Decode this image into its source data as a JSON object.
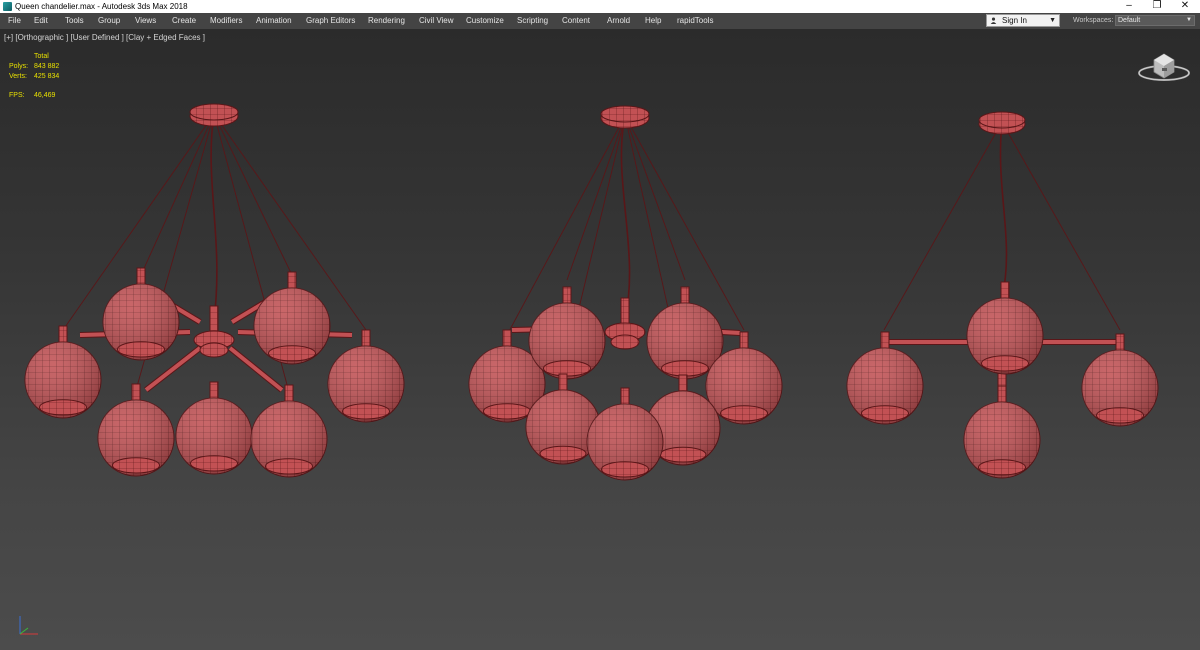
{
  "window": {
    "title": "Queen chandelier.max - Autodesk 3ds Max 2018",
    "controls": {
      "minimize": "–",
      "restore": "❐",
      "close": "✕"
    }
  },
  "menu": {
    "items": [
      "File",
      "Edit",
      "Tools",
      "Group",
      "Views",
      "Create",
      "Modifiers",
      "Animation",
      "Graph Editors",
      "Rendering",
      "Civil View",
      "Customize",
      "Scripting",
      "Content",
      "Arnold",
      "Help",
      "rapidTools"
    ],
    "sign_in": "Sign In",
    "workspaces_label": "Workspaces:",
    "workspace_value": "Default"
  },
  "viewport": {
    "label": "[+] [Orthographic ] [User Defined ] [Clay + Edged Faces ]",
    "stats": {
      "total_label": "Total",
      "polys_label": "Polys:",
      "polys_value": "843 882",
      "verts_label": "Verts:",
      "verts_value": "425 834",
      "fps_label": "FPS:",
      "fps_value": "46,469"
    }
  },
  "colors": {
    "mesh_fill": "#c25154",
    "mesh_wire": "#5a1618",
    "stats_text": "#e8e000",
    "viewport_top": "#2b2b2b",
    "viewport_bottom": "#4c4c4c"
  },
  "icons": [
    "app-icon",
    "user-icon",
    "viewcube-icon",
    "axis-gizmo-icon",
    "chevron-down-icon"
  ]
}
